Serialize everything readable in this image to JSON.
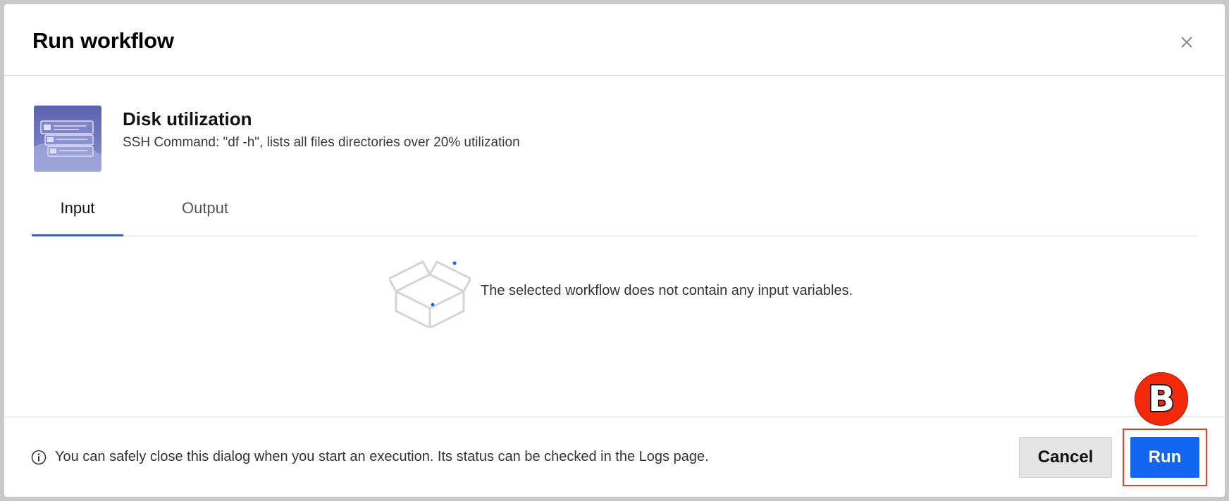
{
  "dialog": {
    "title": "Run workflow",
    "close_icon": "close-icon"
  },
  "workflow": {
    "name": "Disk utilization",
    "description": "SSH Command: \"df -h\", lists all files directories over 20% utilization",
    "thumbnail_icon": "workflow-thumbnail-icon"
  },
  "tabs": [
    {
      "label": "Input",
      "active": true
    },
    {
      "label": "Output",
      "active": false
    }
  ],
  "empty_state": {
    "icon": "open-box-icon",
    "message": "The selected workflow does not contain any input variables."
  },
  "footer": {
    "info_icon": "info-icon",
    "note": "You can safely close this dialog when you start an execution. Its status can be checked in the Logs page.",
    "cancel_label": "Cancel",
    "run_label": "Run"
  },
  "annotation": {
    "marker_label": "B"
  },
  "colors": {
    "accent": "#1266f1",
    "tab_underline": "#1a66e8",
    "highlight_border": "#e8402a",
    "marker_fill": "#f22a0a"
  }
}
